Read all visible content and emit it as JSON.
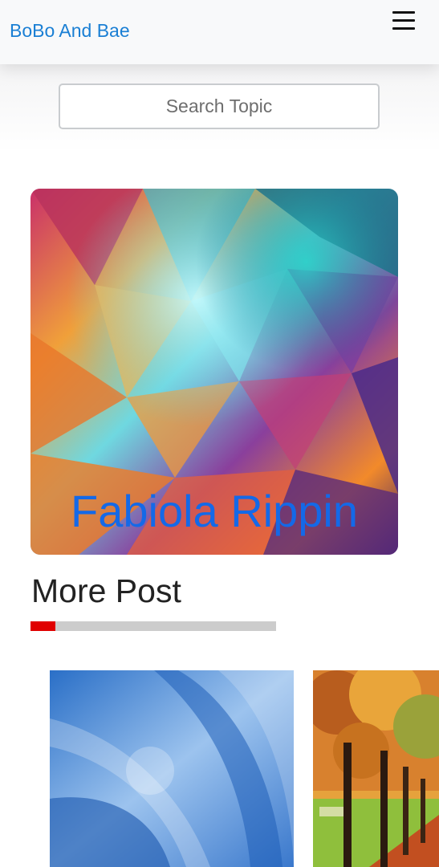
{
  "navbar": {
    "brand": "BoBo And Bae",
    "menu_icon": "hamburger-menu-icon"
  },
  "search": {
    "placeholder": "Search Topic",
    "value": ""
  },
  "hero": {
    "title": "Fabiola Rippin",
    "image": "abstract-colorful-crystal-image"
  },
  "more_posts": {
    "title": "More Post",
    "accent_color": "#e00000",
    "cards": [
      {
        "image": "blue-abstract-curves-image"
      },
      {
        "image": "autumn-trees-path-image"
      }
    ]
  },
  "colors": {
    "brand": "#1a7fd4",
    "hero_title": "#1469e8"
  }
}
